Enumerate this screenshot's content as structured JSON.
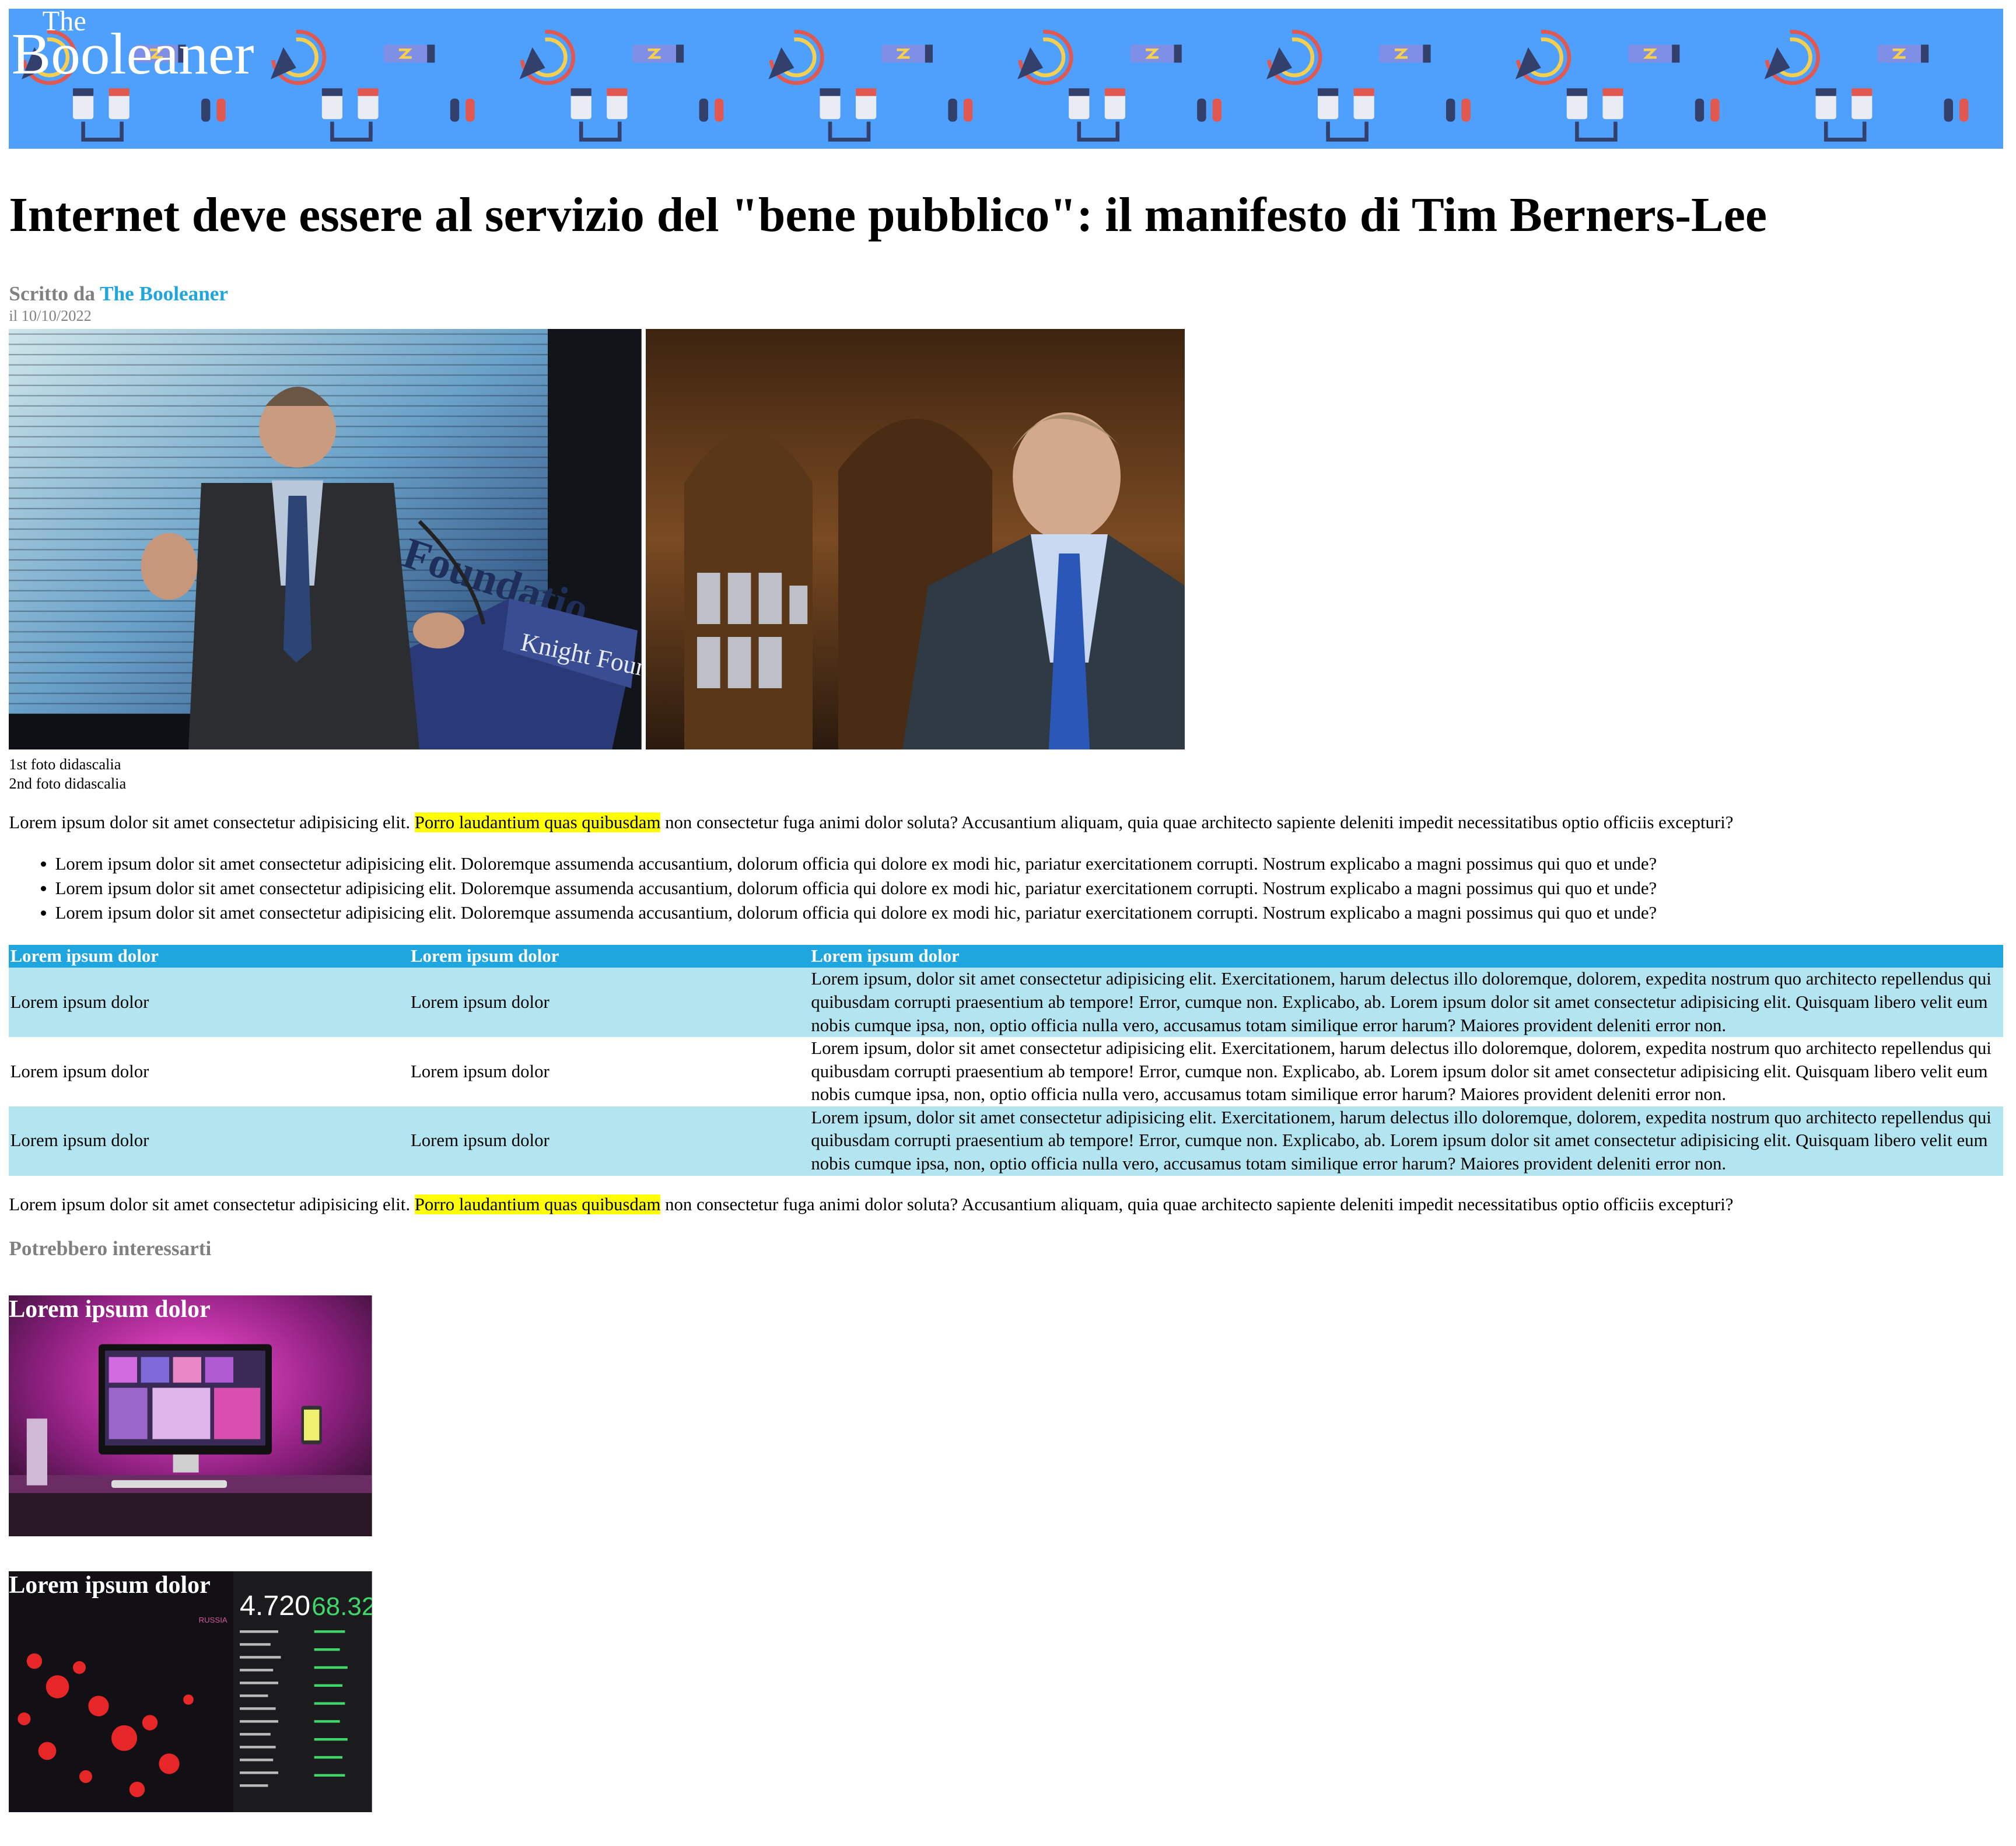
{
  "header": {
    "logo_small": "The",
    "logo_large": "Booleaner"
  },
  "article": {
    "title": "Internet deve essere al servizio del \"bene pubblico\": il manifesto di Tim Berners-Lee",
    "byline_prefix": "Scritto da",
    "author": "The Booleaner",
    "date": "il 10/10/2022",
    "captions": [
      "1st foto didascalia",
      "2nd foto didascalia"
    ],
    "paragraph": {
      "before": "Lorem ipsum dolor sit amet consectetur adipisicing elit. ",
      "highlight": "Porro laudantium quas quibusdam",
      "after": " non consectetur fuga animi dolor soluta? Accusantium aliquam, quia quae architecto sapiente deleniti impedit necessitatibus optio officiis excepturi?"
    },
    "list_items": [
      "Lorem ipsum dolor sit amet consectetur adipisicing elit. Doloremque assumenda accusantium, dolorum officia qui dolore ex modi hic, pariatur exercitationem corrupti. Nostrum explicabo a magni possimus qui quo et unde?",
      "Lorem ipsum dolor sit amet consectetur adipisicing elit. Doloremque assumenda accusantium, dolorum officia qui dolore ex modi hic, pariatur exercitationem corrupti. Nostrum explicabo a magni possimus qui quo et unde?",
      "Lorem ipsum dolor sit amet consectetur adipisicing elit. Doloremque assumenda accusantium, dolorum officia qui dolore ex modi hic, pariatur exercitationem corrupti. Nostrum explicabo a magni possimus qui quo et unde?"
    ],
    "table": {
      "headers": [
        "Lorem ipsum dolor",
        "Lorem ipsum dolor",
        "Lorem ipsum dolor"
      ],
      "rows": [
        [
          "Lorem ipsum dolor",
          "Lorem ipsum dolor",
          "Lorem ipsum, dolor sit amet consectetur adipisicing elit. Exercitationem, harum delectus illo doloremque, dolorem, expedita nostrum quo architecto repellendus qui quibusdam corrupti praesentium ab tempore! Error, cumque non. Explicabo, ab. Lorem ipsum dolor sit amet consectetur adipisicing elit. Quisquam libero velit eum nobis cumque ipsa, non, optio officia nulla vero, accusamus totam similique error harum? Maiores provident deleniti error non."
        ],
        [
          "Lorem ipsum dolor",
          "Lorem ipsum dolor",
          "Lorem ipsum, dolor sit amet consectetur adipisicing elit. Exercitationem, harum delectus illo doloremque, dolorem, expedita nostrum quo architecto repellendus qui quibusdam corrupti praesentium ab tempore! Error, cumque non. Explicabo, ab. Lorem ipsum dolor sit amet consectetur adipisicing elit. Quisquam libero velit eum nobis cumque ipsa, non, optio officia nulla vero, accusamus totam similique error harum? Maiores provident deleniti error non."
        ],
        [
          "Lorem ipsum dolor",
          "Lorem ipsum dolor",
          "Lorem ipsum, dolor sit amet consectetur adipisicing elit. Exercitationem, harum delectus illo doloremque, dolorem, expedita nostrum quo architecto repellendus qui quibusdam corrupti praesentium ab tempore! Error, cumque non. Explicabo, ab. Lorem ipsum dolor sit amet consectetur adipisicing elit. Quisquam libero velit eum nobis cumque ipsa, non, optio officia nulla vero, accusamus totam similique error harum? Maiores provident deleniti error non."
        ]
      ]
    }
  },
  "related": {
    "heading": "Potrebbero interessarti",
    "cards": [
      {
        "title": "Lorem ipsum dolor",
        "scene": "desk-setup-magenta"
      },
      {
        "title": "Lorem ipsum dolor",
        "scene": "covid-dashboard-map"
      }
    ]
  },
  "colors": {
    "banner": "#4f9ffd",
    "link": "#20a6de",
    "table_header": "#20a6de",
    "table_stripe": "#b3e5f1",
    "highlight": "#ffff00"
  }
}
